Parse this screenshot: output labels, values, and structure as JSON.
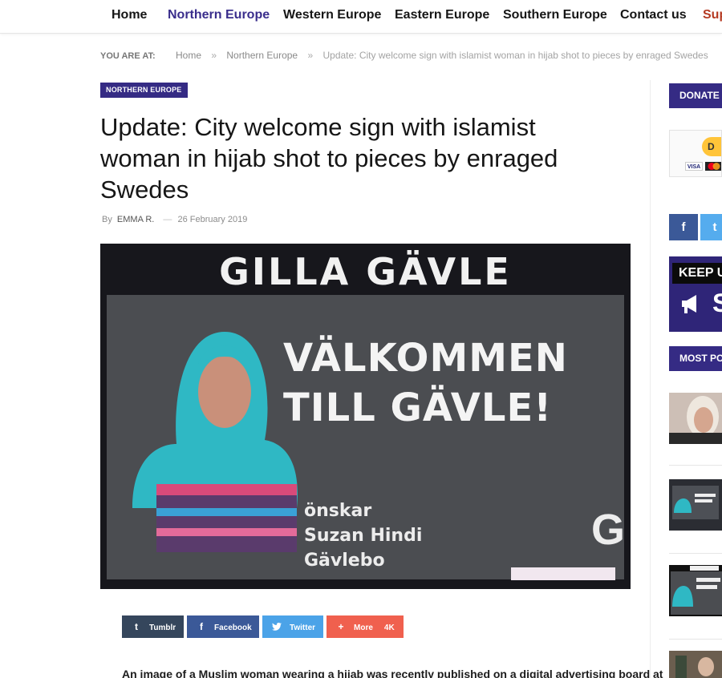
{
  "nav": {
    "items": [
      {
        "label": "Home"
      },
      {
        "label": "Northern Europe"
      },
      {
        "label": "Western Europe"
      },
      {
        "label": "Eastern Europe"
      },
      {
        "label": "Southern Europe"
      },
      {
        "label": "Contact us"
      },
      {
        "label": "Sup"
      }
    ],
    "active": "Northern Europe"
  },
  "breadcrumb": {
    "label": "YOU ARE AT:",
    "items": [
      "Home",
      "Northern Europe"
    ],
    "current": "Update: City welcome sign with islamist woman in hijab shot to pieces by enraged Swedes",
    "separator": "»"
  },
  "article": {
    "category": "NORTHERN EUROPE",
    "title": "Update: City welcome sign with islamist woman in hijab shot to pieces by enraged Swedes",
    "meta": {
      "by": "By",
      "author": "EMMA R.",
      "dash": "—",
      "date": "26 February 2019"
    },
    "image": {
      "headline": "GILLA GÄVLE",
      "welcome_line1": "VÄLKOMMEN",
      "welcome_line2": "TILL GÄVLE!",
      "sub_line1": "önskar",
      "sub_line2": "Suzan Hindi",
      "sub_line3": "Gävlebo",
      "logo_letter": "G"
    },
    "shares": [
      {
        "label": "Tumblr",
        "icon": "tumblr-icon",
        "glyph": "t",
        "color": "#35465c"
      },
      {
        "label": "Facebook",
        "icon": "facebook-icon",
        "glyph": "f",
        "color": "#3b5998"
      },
      {
        "label": "Twitter",
        "icon": "twitter-icon",
        "glyph": "🐦",
        "color": "#4ba3e8"
      },
      {
        "label": "More",
        "icon": "plus-icon",
        "glyph": "+",
        "color": "#f0604e",
        "count": "4K"
      }
    ],
    "body_first_line": "An image of a Muslim woman wearing a hijab was recently published on a digital advertising board at"
  },
  "sidebar": {
    "donate_header": "DONATE",
    "paypal_label": "D",
    "card_visa": "VISA",
    "social": [
      {
        "icon": "facebook-icon",
        "glyph": "f",
        "color": "#3b5998"
      },
      {
        "icon": "twitter-icon",
        "glyph": "t",
        "color": "#55acee"
      }
    ],
    "keep_text": "KEEP U",
    "keep_big": "S",
    "most_popular_header": "MOST PO"
  },
  "colors": {
    "brand": "#352b84",
    "nav_active": "#3a2e8c"
  }
}
